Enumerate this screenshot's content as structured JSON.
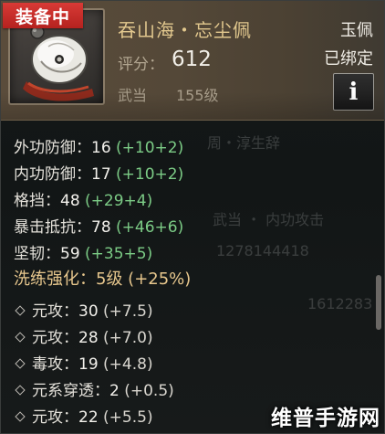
{
  "badge": {
    "label": "装备中",
    "color": "#c92b28"
  },
  "item": {
    "name": "吞山海・忘尘佩",
    "score_label": "评分：",
    "score": "612",
    "school": "武当",
    "level": "155级",
    "type": "玉佩",
    "bound": "已绑定",
    "info_button": "i",
    "icon": "jade-pendant-icon"
  },
  "stats": [
    {
      "name": "外功防御",
      "colon": "：",
      "value": "16",
      "bonus": "(+10+2)"
    },
    {
      "name": "内功防御",
      "colon": "：",
      "value": "17",
      "bonus": "(+10+2)"
    },
    {
      "name": "格挡",
      "colon": "：",
      "value": "48",
      "bonus": "(+29+4)"
    },
    {
      "name": "暴击抵抗",
      "colon": "：",
      "value": "78",
      "bonus": "(+46+6)"
    },
    {
      "name": "坚韧",
      "colon": "：",
      "value": "59",
      "bonus": "(+35+5)"
    }
  ],
  "refine": {
    "label": "洗练强化：",
    "value": "5级 (+25%)"
  },
  "attributes": [
    {
      "name": "元攻",
      "colon": "：",
      "value": "30",
      "bonus": "(+7.5)"
    },
    {
      "name": "元攻",
      "colon": "：",
      "value": "28",
      "bonus": "(+7.0)"
    },
    {
      "name": "毒攻",
      "colon": "：",
      "value": "19",
      "bonus": "(+4.8)"
    },
    {
      "name": "元系穿透",
      "colon": "：",
      "value": "2",
      "bonus": "(+0.5)"
    },
    {
      "name": "元攻",
      "colon": "：",
      "value": "22",
      "bonus": "(+5.5)"
    }
  ],
  "background_ghost_text": [
    "周・淳生辞",
    "武当 ・ 内功攻击",
    "1278144418",
    "1612283"
  ],
  "watermark": "维普手游网",
  "colors": {
    "bonus_green": "#7ccc86",
    "gold_text": "#e2c88e",
    "header_bg": "#544838"
  }
}
